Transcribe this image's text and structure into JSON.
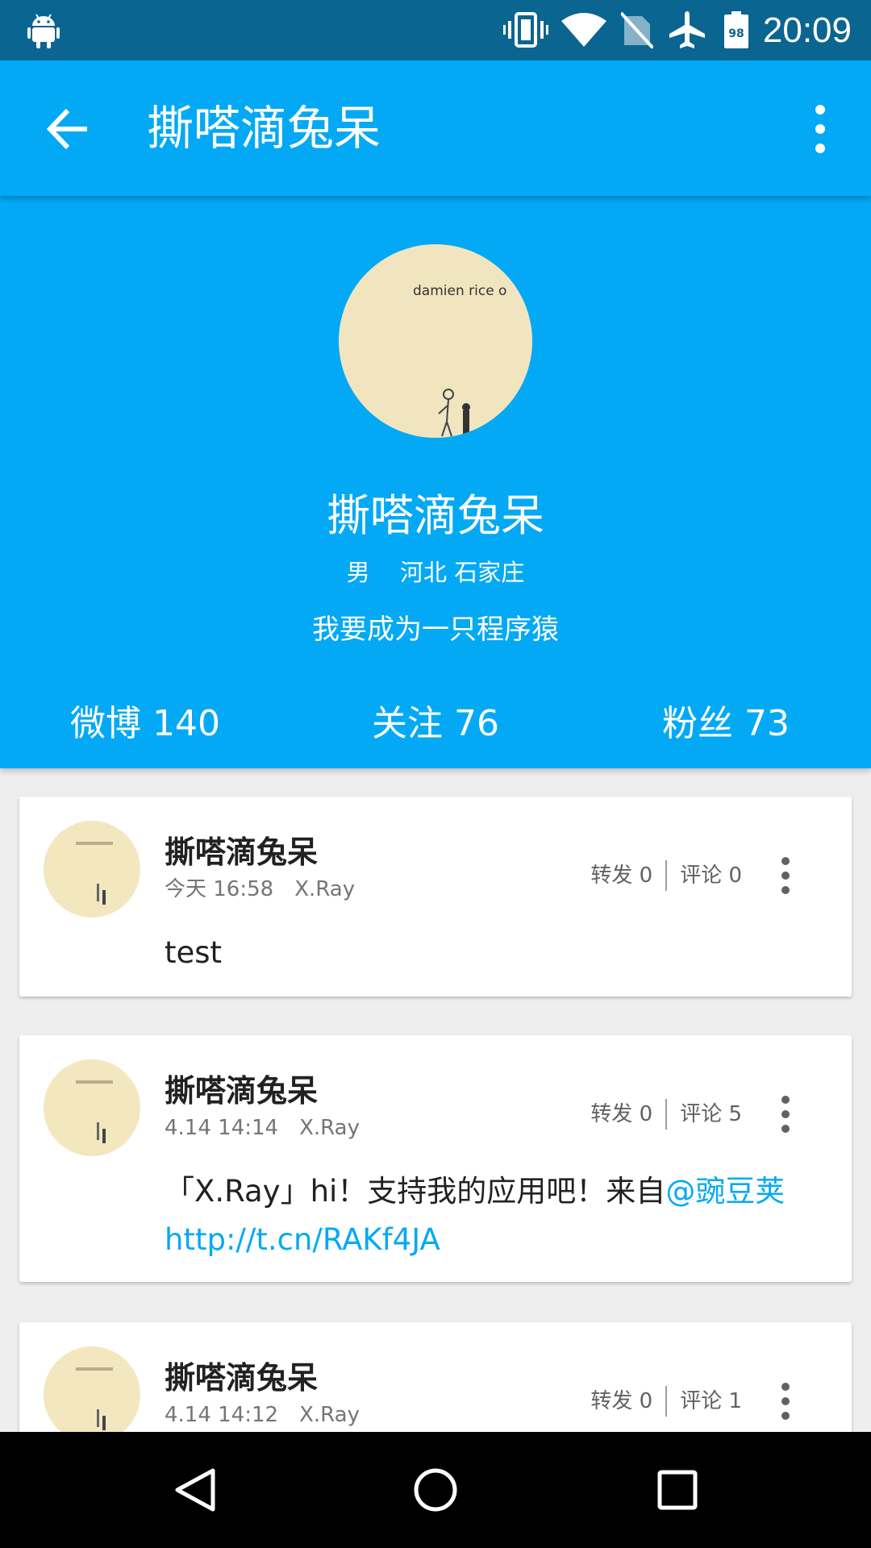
{
  "status_bar": {
    "time": "20:09",
    "battery_level": "98",
    "icons": [
      "android-icon",
      "vibrate-icon",
      "wifi-icon",
      "no-sim-icon",
      "airplane-icon",
      "battery-icon"
    ]
  },
  "app_bar": {
    "title": "撕嗒滴兔呆",
    "back_icon": "arrow-back-icon",
    "more_icon": "more-vert-icon"
  },
  "profile": {
    "avatar_text": "damien rice o",
    "name": "撕嗒滴兔呆",
    "gender": "男",
    "location": "河北 石家庄",
    "bio": "我要成为一只程序猿",
    "stats": {
      "weibo": "微博 140",
      "following": "关注 76",
      "fans": "粉丝 73"
    }
  },
  "feed": [
    {
      "name": "撕嗒滴兔呆",
      "time": "今天 16:58",
      "source": "X.Ray",
      "reposts": "转发 0",
      "comments": "评论 0",
      "text": "test"
    },
    {
      "name": "撕嗒滴兔呆",
      "time": "4.14 14:14",
      "source": "X.Ray",
      "reposts": "转发 0",
      "comments": "评论 5",
      "text": "「X.Ray」hi！支持我的应用吧！来自",
      "mention": "@豌豆荚",
      "link": "http://t.cn/RAKf4JA"
    },
    {
      "name": "撕嗒滴兔呆",
      "time": "4.14 14:12",
      "source": "X.Ray",
      "reposts": "转发 0",
      "comments": "评论 1"
    }
  ],
  "colors": {
    "primary": "#03a9f4",
    "status_bar": "#0a6590",
    "link": "#03a9f4"
  }
}
